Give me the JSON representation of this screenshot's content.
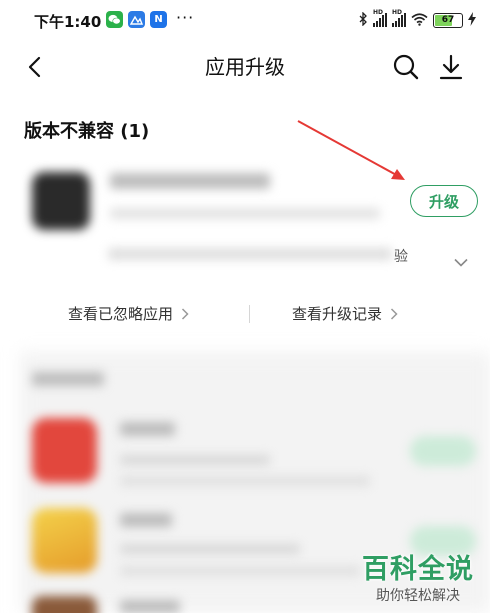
{
  "status_bar": {
    "time": "下午1:40",
    "app_icon_n": "N",
    "dots": "···",
    "hd1": "HD",
    "hd2": "HD",
    "battery": "67"
  },
  "header": {
    "title": "应用升级",
    "icons": [
      "back-icon",
      "search-icon",
      "download-icon"
    ]
  },
  "incompatible_section": {
    "title": "版本不兼容 (1)",
    "upgrade_label": "升级",
    "clipped_char": "验"
  },
  "links": {
    "ignored": "查看已忽略应用",
    "history": "查看升级记录"
  },
  "watermark": {
    "brand": "百科全说",
    "tagline": "助你轻松解决"
  },
  "colors": {
    "accent": "#2f9e63",
    "annotation": "#e53935"
  }
}
